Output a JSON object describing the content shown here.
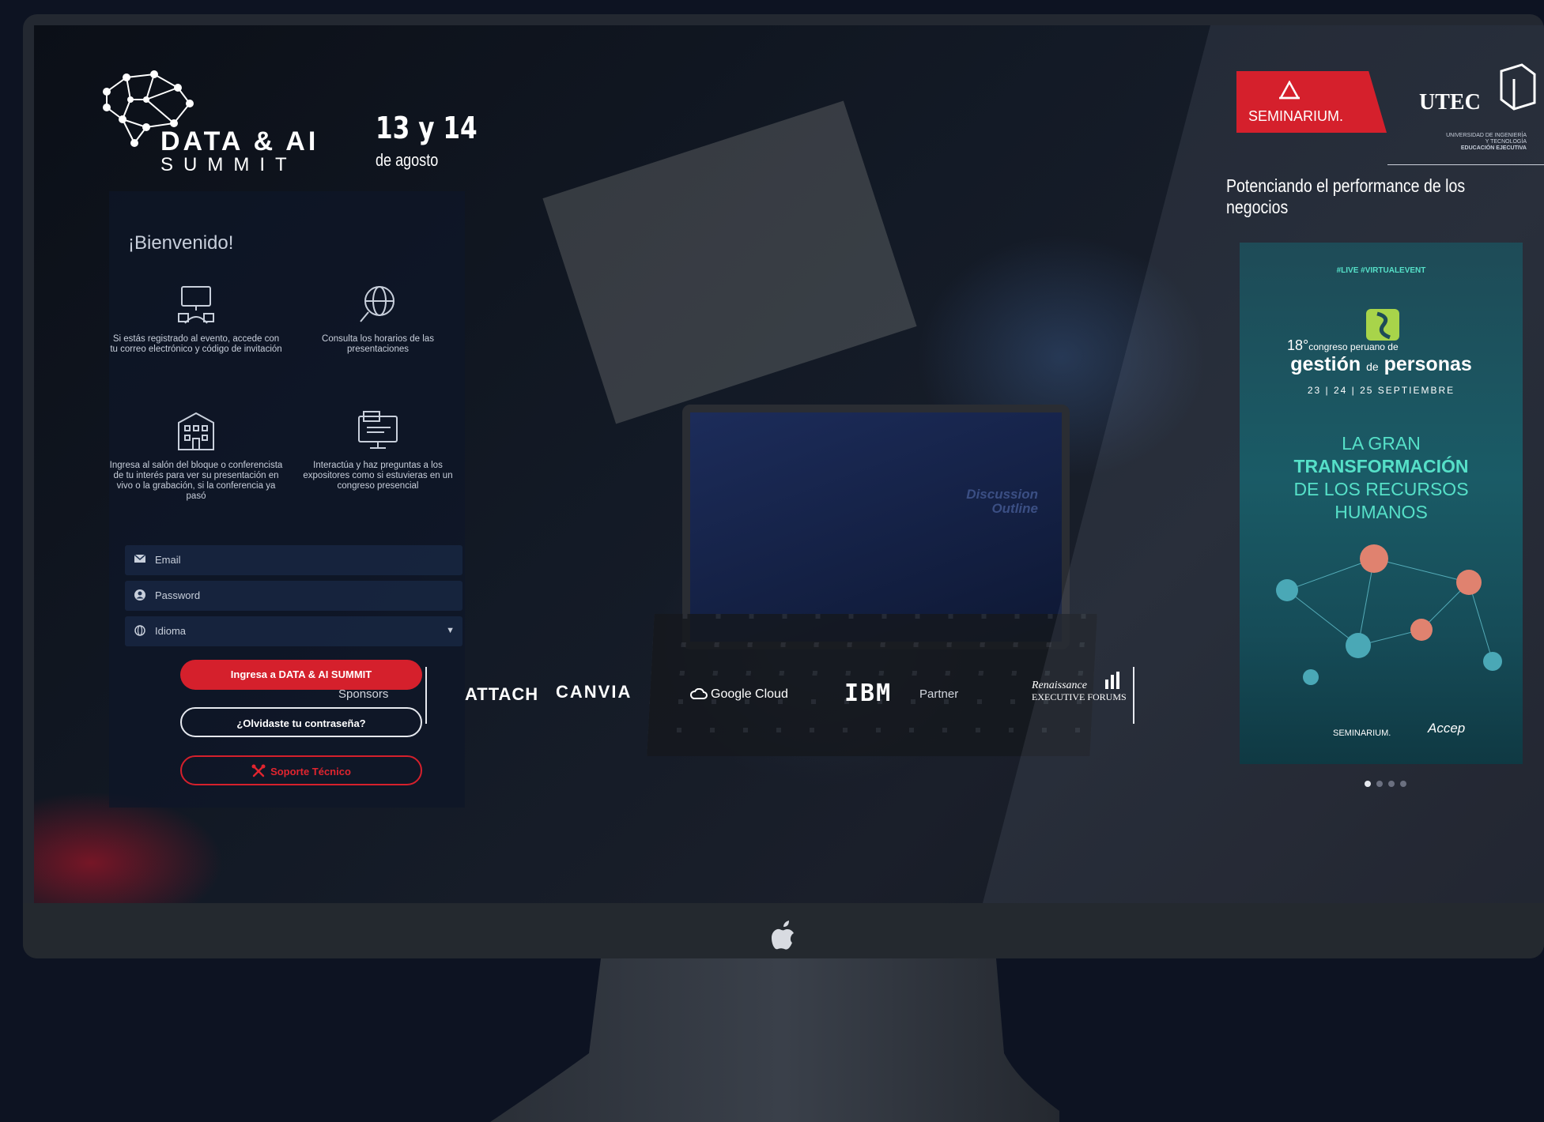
{
  "event": {
    "name_line1": "DATA & AI",
    "name_line2": "SUMMIT",
    "date_main": "13 y 14",
    "date_sub": "de agosto"
  },
  "login": {
    "welcome": "¡Bienvenido!",
    "features": [
      {
        "icon": "computer-user-icon",
        "text": "Si estás registrado al evento, accede con tu correo electrónico y código de invitación"
      },
      {
        "icon": "globe-search-icon",
        "text": "Consulta los horarios de las presentaciones"
      },
      {
        "icon": "building-icon",
        "text": "Ingresa al salón del bloque o conferencista de tu interés para ver su presentación en vivo o la grabación, si la conferencia ya pasó"
      },
      {
        "icon": "monitor-chat-icon",
        "text": "Interactúa y haz preguntas a los expositores como si estuvieras en un congreso presencial"
      }
    ],
    "email_placeholder": "Email",
    "password_placeholder": "Password",
    "language_label": "Idioma",
    "submit_label": "Ingresa a DATA & AI SUMMIT",
    "forgot_label": "¿Olvidaste tu contraseña?",
    "support_label": "Soporte Técnico"
  },
  "header_right": {
    "seminarium": "SEMINARIUM.",
    "utec": "UTEC",
    "utec_sub": "UNIVERSIDAD DE INGENIERÍA Y TECNOLOGÍA",
    "utec_exec": "EDUCACIÓN EJECUTIVA",
    "tagline": "Potenciando el performance de los negocios"
  },
  "banner": {
    "tags": "#LIVE  #VIRTUALEVENT",
    "number": "18°",
    "congreso": "congreso peruano de",
    "gestion": "gestión",
    "de": "de",
    "personas": "personas",
    "dates": "23 | 24 | 25 SEPTIEMBRE",
    "headline_1": "LA GRAN",
    "headline_2": "TRANSFORMACIÓN",
    "headline_3": "DE LOS RECURSOS",
    "headline_4": "HUMANOS",
    "footer_left": "SEMINARIUM.",
    "footer_right": "Accep",
    "slides": 4,
    "active_slide": 1
  },
  "sponsors": {
    "label": "Sponsors",
    "logos": [
      "ATTACH",
      "CANVIA",
      "Google Cloud",
      "IBM"
    ],
    "partner_label": "Partner",
    "partner_line1": "Renaissance",
    "partner_line2": "EXECUTIVE FORUMS"
  },
  "background_screen_text": {
    "laptop_line1": "Discussion",
    "laptop_line2": "Outline"
  },
  "colors": {
    "accent_red": "#d5202c",
    "teal": "#56e0c8",
    "panel_bg": "#0e1628"
  }
}
